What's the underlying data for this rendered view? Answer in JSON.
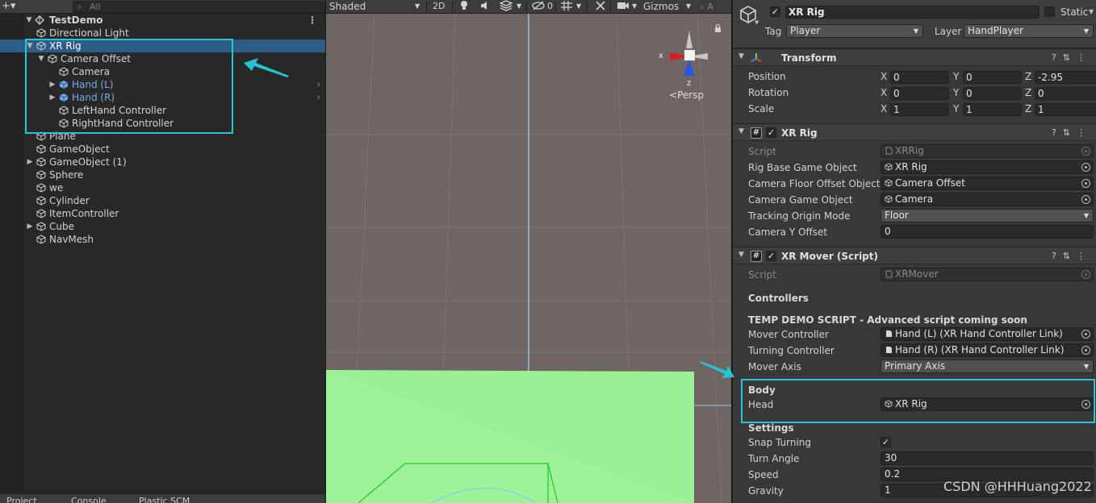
{
  "hierarchy": {
    "add_label": "+▾",
    "search_placeholder": "All",
    "scene_name": "TestDemo",
    "items": [
      {
        "label": "Directional Light",
        "depth": 0,
        "arrow": "",
        "prefab": false
      },
      {
        "label": "XR Rig",
        "depth": 0,
        "arrow": "▼",
        "prefab": false,
        "selected": true
      },
      {
        "label": "Camera Offset",
        "depth": 1,
        "arrow": "▼",
        "prefab": false
      },
      {
        "label": "Camera",
        "depth": 2,
        "arrow": "",
        "prefab": false
      },
      {
        "label": "Hand (L)",
        "depth": 2,
        "arrow": "▶",
        "prefab": true,
        "more": "›"
      },
      {
        "label": "Hand (R)",
        "depth": 2,
        "arrow": "▶",
        "prefab": true,
        "more": "›"
      },
      {
        "label": "LeftHand Controller",
        "depth": 2,
        "arrow": "",
        "prefab": false
      },
      {
        "label": "RightHand Controller",
        "depth": 2,
        "arrow": "",
        "prefab": false
      },
      {
        "label": "Plane",
        "depth": 0,
        "arrow": "",
        "prefab": false
      },
      {
        "label": "GameObject",
        "depth": 0,
        "arrow": "",
        "prefab": false
      },
      {
        "label": "GameObject (1)",
        "depth": 0,
        "arrow": "▶",
        "prefab": false
      },
      {
        "label": "Sphere",
        "depth": 0,
        "arrow": "",
        "prefab": false
      },
      {
        "label": "we",
        "depth": 0,
        "arrow": "",
        "prefab": false
      },
      {
        "label": "Cylinder",
        "depth": 0,
        "arrow": "",
        "prefab": false
      },
      {
        "label": "ItemController",
        "depth": 0,
        "arrow": "",
        "prefab": false
      },
      {
        "label": "Cube",
        "depth": 0,
        "arrow": "▶",
        "prefab": false
      },
      {
        "label": "NavMesh",
        "depth": 0,
        "arrow": "",
        "prefab": false
      }
    ],
    "bottom_tabs": [
      "Project",
      "Console",
      "Plastic SCM"
    ]
  },
  "scene": {
    "shading_mode": "Shaded",
    "mode_2d": "2D",
    "hidden_count": "0",
    "gizmos_label": "Gizmos",
    "search_placeholder": "A",
    "persp_label": "Persp",
    "axis_x": "x",
    "axis_z": "z"
  },
  "inspector": {
    "object_name": "XR Rig",
    "static_label": "Static",
    "tag_label": "Tag",
    "tag_value": "Player",
    "layer_label": "Layer",
    "layer_value": "HandPlayer",
    "transform": {
      "title": "Transform",
      "rows": [
        {
          "label": "Position",
          "x": "0",
          "y": "0",
          "z": "-2.95"
        },
        {
          "label": "Rotation",
          "x": "0",
          "y": "0",
          "z": "0"
        },
        {
          "label": "Scale",
          "x": "1",
          "y": "1",
          "z": "1"
        }
      ]
    },
    "xr_rig": {
      "title": "XR Rig",
      "script_label": "Script",
      "script_value": "XRRig",
      "rig_base_label": "Rig Base Game Object",
      "rig_base_value": "XR Rig",
      "floor_offset_label": "Camera Floor Offset Object",
      "floor_offset_value": "Camera Offset",
      "camera_go_label": "Camera Game Object",
      "camera_go_value": "Camera",
      "tracking_label": "Tracking Origin Mode",
      "tracking_value": "Floor",
      "camera_y_label": "Camera Y Offset",
      "camera_y_value": "0"
    },
    "xr_mover": {
      "title": "XR Mover (Script)",
      "script_label": "Script",
      "script_value": "XRMover",
      "controllers_header": "Controllers",
      "temp_header": "TEMP DEMO SCRIPT - Advanced script coming soon",
      "mover_label": "Mover Controller",
      "mover_value": "Hand (L) (XR Hand Controller Link)",
      "turning_label": "Turning Controller",
      "turning_value": "Hand (R) (XR Hand Controller Link)",
      "axis_label": "Mover Axis",
      "axis_value": "Primary Axis",
      "body_header": "Body",
      "head_label": "Head",
      "head_value": "XR Rig",
      "settings_header": "Settings",
      "snap_label": "Snap Turning",
      "snap_value": "✓",
      "turn_angle_label": "Turn Angle",
      "turn_angle_value": "30",
      "speed_label": "Speed",
      "speed_value": "0.2",
      "gravity_label": "Gravity",
      "gravity_value": "1"
    }
  },
  "watermark": "CSDN @HHHuang2022",
  "colors": {
    "highlight": "#27c4d4",
    "selection": "#2c5d87",
    "plane_green": "#9ef29a",
    "prefab_blue": "#7aa8e4"
  }
}
